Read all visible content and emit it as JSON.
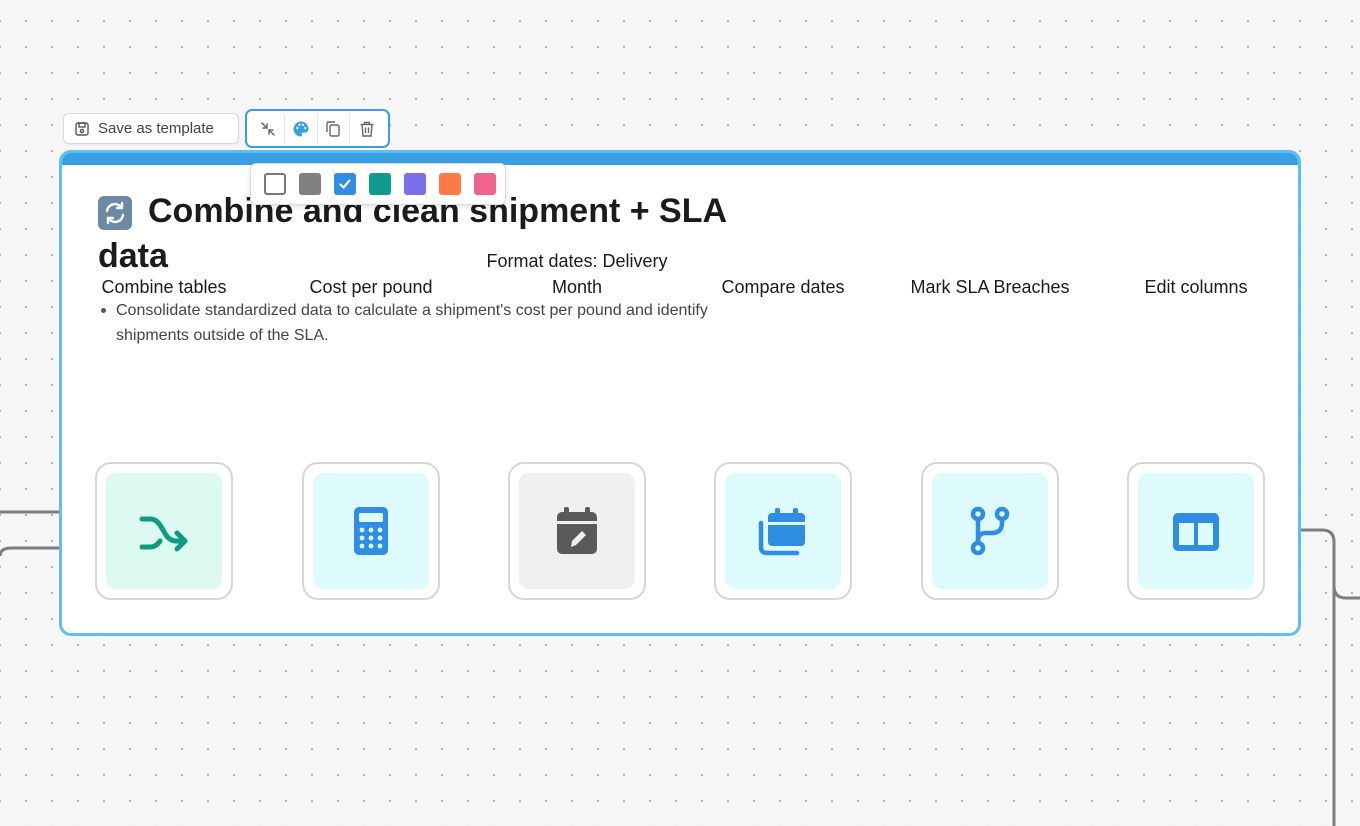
{
  "toolbar": {
    "save_template_label": "Save as template",
    "tools": [
      "collapse-icon",
      "palette-icon",
      "copy-icon",
      "trash-icon"
    ]
  },
  "color_picker": {
    "swatches": [
      "#ffffff",
      "#808080",
      "#2f8de4",
      "#0f9b8e",
      "#7b6fe8",
      "#ff7a45",
      "#f0648c"
    ],
    "selected": "#2f8de4"
  },
  "group": {
    "title": "Combine and clean shipment + SLA data",
    "emoji": "arrows-cycle-icon",
    "description": "Consolidate standardized data to calculate a shipment's cost per pound and identify shipments outside of the SLA.",
    "accent": "#3aa0e4"
  },
  "steps": [
    {
      "label": "Combine tables",
      "icon": "merge-icon",
      "bg": "#dcfaf0",
      "color": "#0f9b80"
    },
    {
      "label": "Cost per pound",
      "icon": "calculator-icon",
      "bg": "#ddfbfd",
      "color": "#2f8de4"
    },
    {
      "label": "Format dates: Delivery Month",
      "icon": "calendar-edit-icon",
      "bg": "#f0f0f0",
      "color": "#5a5a5a"
    },
    {
      "label": "Compare dates",
      "icon": "calendars-icon",
      "bg": "#ddfbfd",
      "color": "#2f8de4"
    },
    {
      "label": "Mark SLA Breaches",
      "icon": "branch-icon",
      "bg": "#ddfbfd",
      "color": "#2f8de4"
    },
    {
      "label": "Edit columns",
      "icon": "columns-icon",
      "bg": "#ddfbfd",
      "color": "#2f8de4"
    }
  ]
}
